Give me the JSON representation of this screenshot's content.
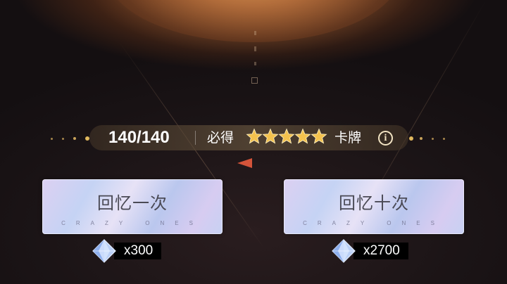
{
  "draw_bar": {
    "progress": "140/140",
    "guarantee_label": "必得",
    "star_count": 5,
    "card_label": "卡牌",
    "info_symbol": "i"
  },
  "buttons": [
    {
      "label": "回忆一次",
      "sub_label": "CRAZY ONES",
      "cost_amount": "x300",
      "cost_icon": "crystal-gem-icon"
    },
    {
      "label": "回忆十次",
      "sub_label": "CRAZY ONES",
      "cost_amount": "x2700",
      "cost_icon": "crystal-gem-icon"
    }
  ],
  "colors": {
    "star_gold": "#f4c24e",
    "marker_red": "#d4543a",
    "button_gradient_start": "#dcd0f2",
    "button_gradient_end": "#c7d1f3"
  }
}
